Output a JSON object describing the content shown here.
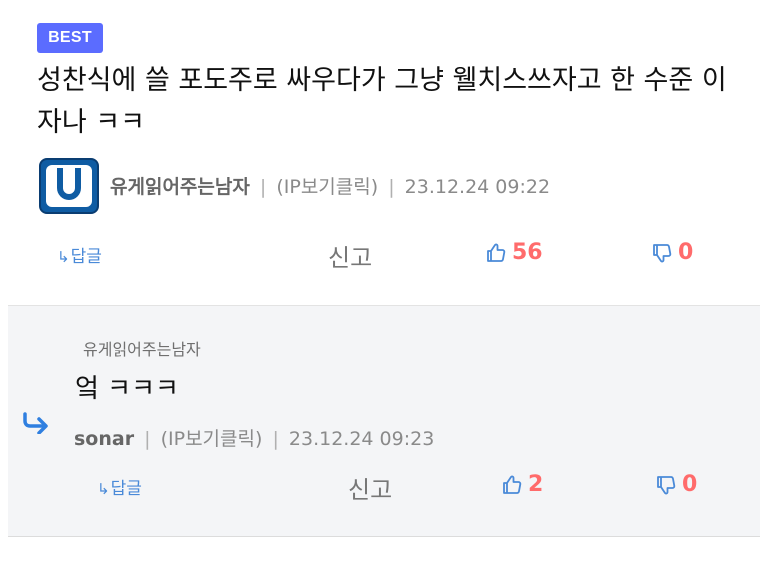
{
  "best_comment": {
    "badge": "BEST",
    "content": "성찬식에 쓸 포도주로 싸우다가 그냥 웰치스쓰자고 한 수준 이자나 ㅋㅋ",
    "author": "유게읽어주는남자",
    "ip_label": "(IP보기클릭)",
    "timestamp": "23.12.24 09:22",
    "reply_label": "답글",
    "report_label": "신고",
    "likes": "56",
    "dislikes": "0",
    "avatar_icon": "avatar-u-logo-icon"
  },
  "reply_comment": {
    "reply_to": "유게읽어주는남자",
    "content": "엌 ㅋㅋㅋ",
    "author": "sonar",
    "ip_label": "(IP보기클릭)",
    "timestamp": "23.12.24 09:23",
    "reply_label": "답글",
    "report_label": "신고",
    "likes": "2",
    "dislikes": "0"
  },
  "separator": "|",
  "colors": {
    "best_badge": "#5b6cff",
    "like_red": "#ff6b6b",
    "link_blue": "#4a8ad8",
    "reply_bg": "#f4f5f7"
  }
}
